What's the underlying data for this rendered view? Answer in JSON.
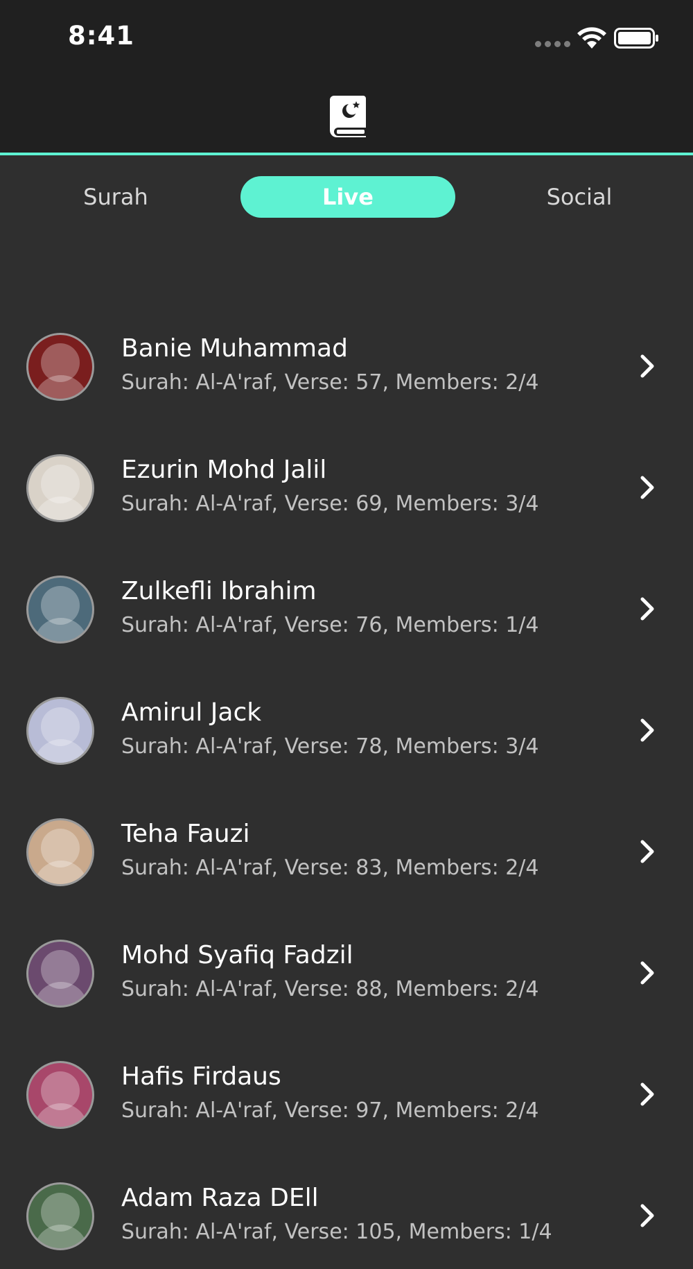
{
  "status_bar": {
    "time": "8:41"
  },
  "header": {
    "logo_icon": "quran-book-icon",
    "accent_color": "#5ef2d2"
  },
  "tabs": [
    {
      "label": "Surah",
      "active": false
    },
    {
      "label": "Live",
      "active": true
    },
    {
      "label": "Social",
      "active": false
    }
  ],
  "live_sessions": [
    {
      "name": "Banie Muhammad",
      "detail": "Surah: Al-A'raf, Verse: 57, Members: 2/4",
      "avatar_color": "#7a1e1e"
    },
    {
      "name": "Ezurin Mohd Jalil",
      "detail": "Surah: Al-A'raf, Verse: 69, Members: 3/4",
      "avatar_color": "#d9d2c8"
    },
    {
      "name": "Zulkefli Ibrahim",
      "detail": "Surah: Al-A'raf, Verse: 76, Members: 1/4",
      "avatar_color": "#4d6a7a"
    },
    {
      "name": "Amirul Jack",
      "detail": "Surah: Al-A'raf, Verse: 78, Members: 3/4",
      "avatar_color": "#b8bcd6"
    },
    {
      "name": "Teha Fauzi",
      "detail": "Surah: Al-A'raf, Verse: 83, Members: 2/4",
      "avatar_color": "#c9a98c"
    },
    {
      "name": "Mohd Syafiq Fadzil",
      "detail": "Surah: Al-A'raf, Verse: 88, Members: 2/4",
      "avatar_color": "#6b4a6e"
    },
    {
      "name": "Hafis Firdaus",
      "detail": "Surah: Al-A'raf, Verse: 97, Members: 2/4",
      "avatar_color": "#a8476a"
    },
    {
      "name": "Adam Raza DEll",
      "detail": "Surah: Al-A'raf, Verse: 105, Members: 1/4",
      "avatar_color": "#4a6a4a"
    }
  ]
}
